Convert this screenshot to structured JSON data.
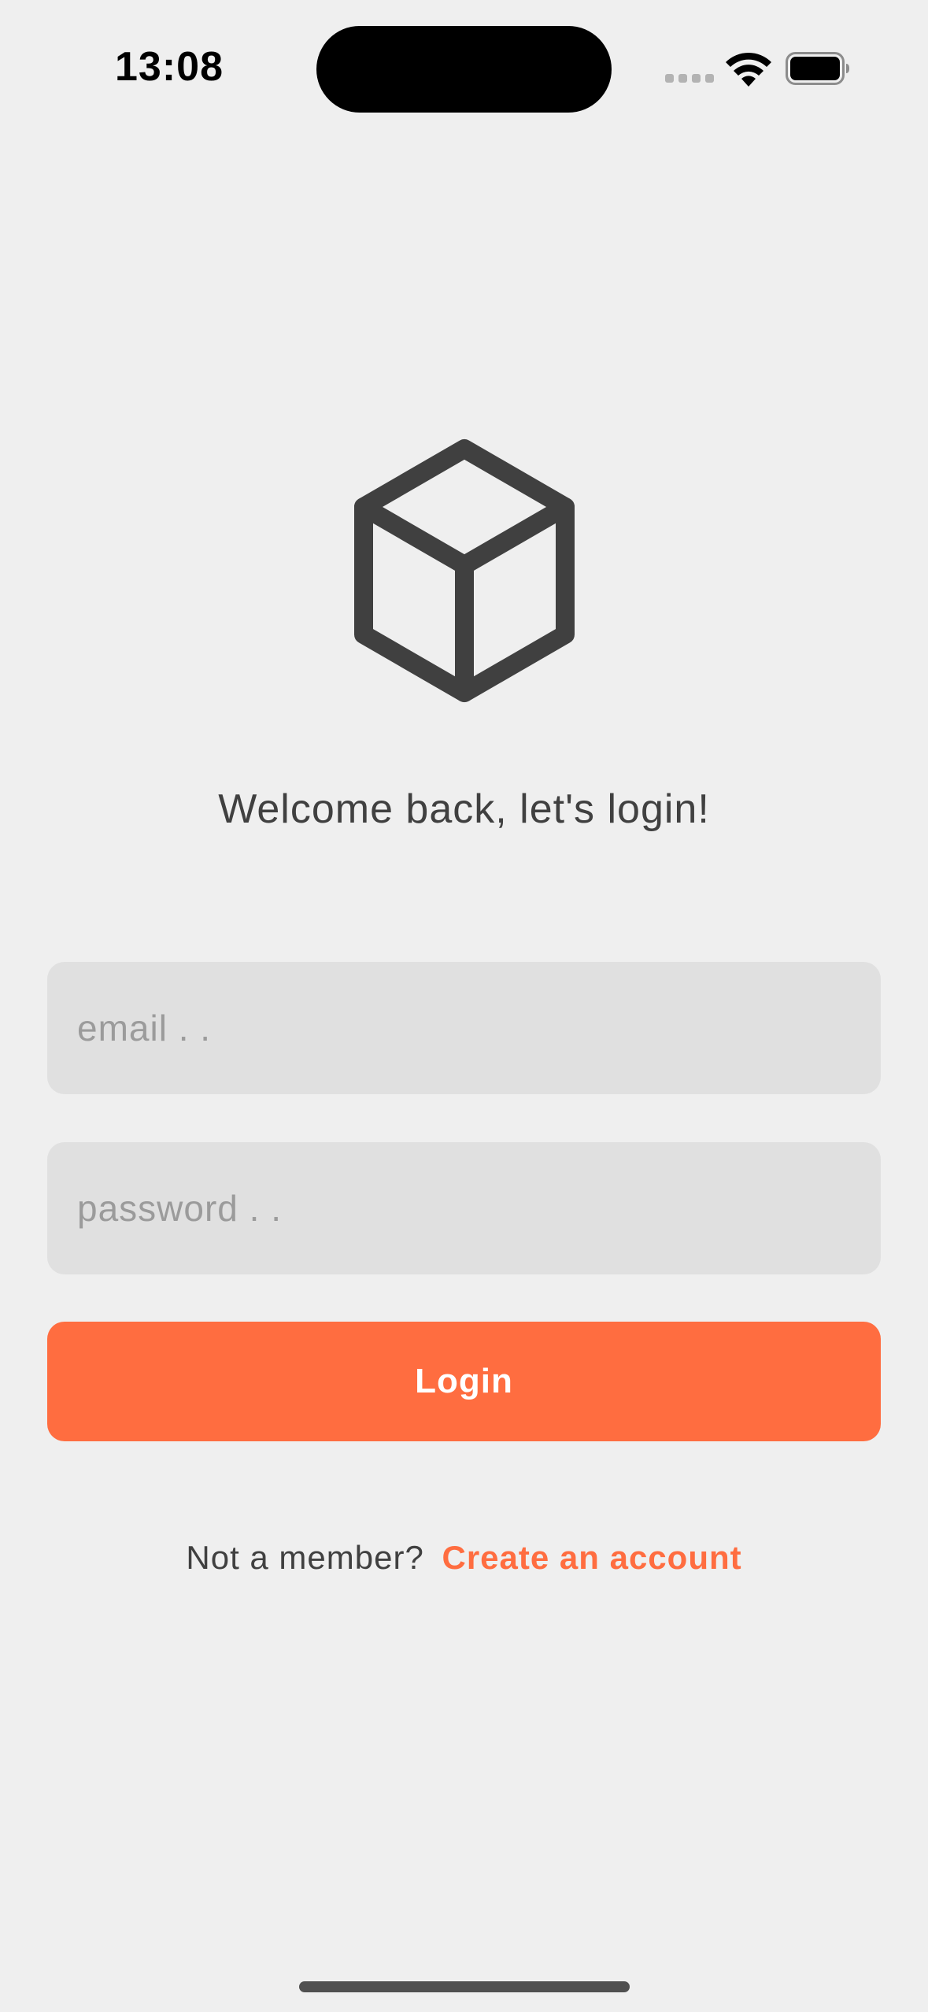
{
  "status_bar": {
    "time": "13:08",
    "icons": [
      "signal-icon",
      "wifi-icon",
      "battery-icon"
    ]
  },
  "logo": {
    "icon": "cube-icon",
    "color": "#404040"
  },
  "welcome_text": "Welcome back, let's login!",
  "form": {
    "email": {
      "value": "",
      "placeholder": "email . ."
    },
    "password": {
      "value": "",
      "placeholder": "password . ."
    },
    "login_label": "Login"
  },
  "register": {
    "prompt": "Not a member?",
    "link_label": "Create an account"
  },
  "colors": {
    "background": "#EFEFEF",
    "accent": "#FF6D40",
    "field_background": "#E0E0E0",
    "text": "#404040",
    "placeholder": "#9B9B9B"
  }
}
